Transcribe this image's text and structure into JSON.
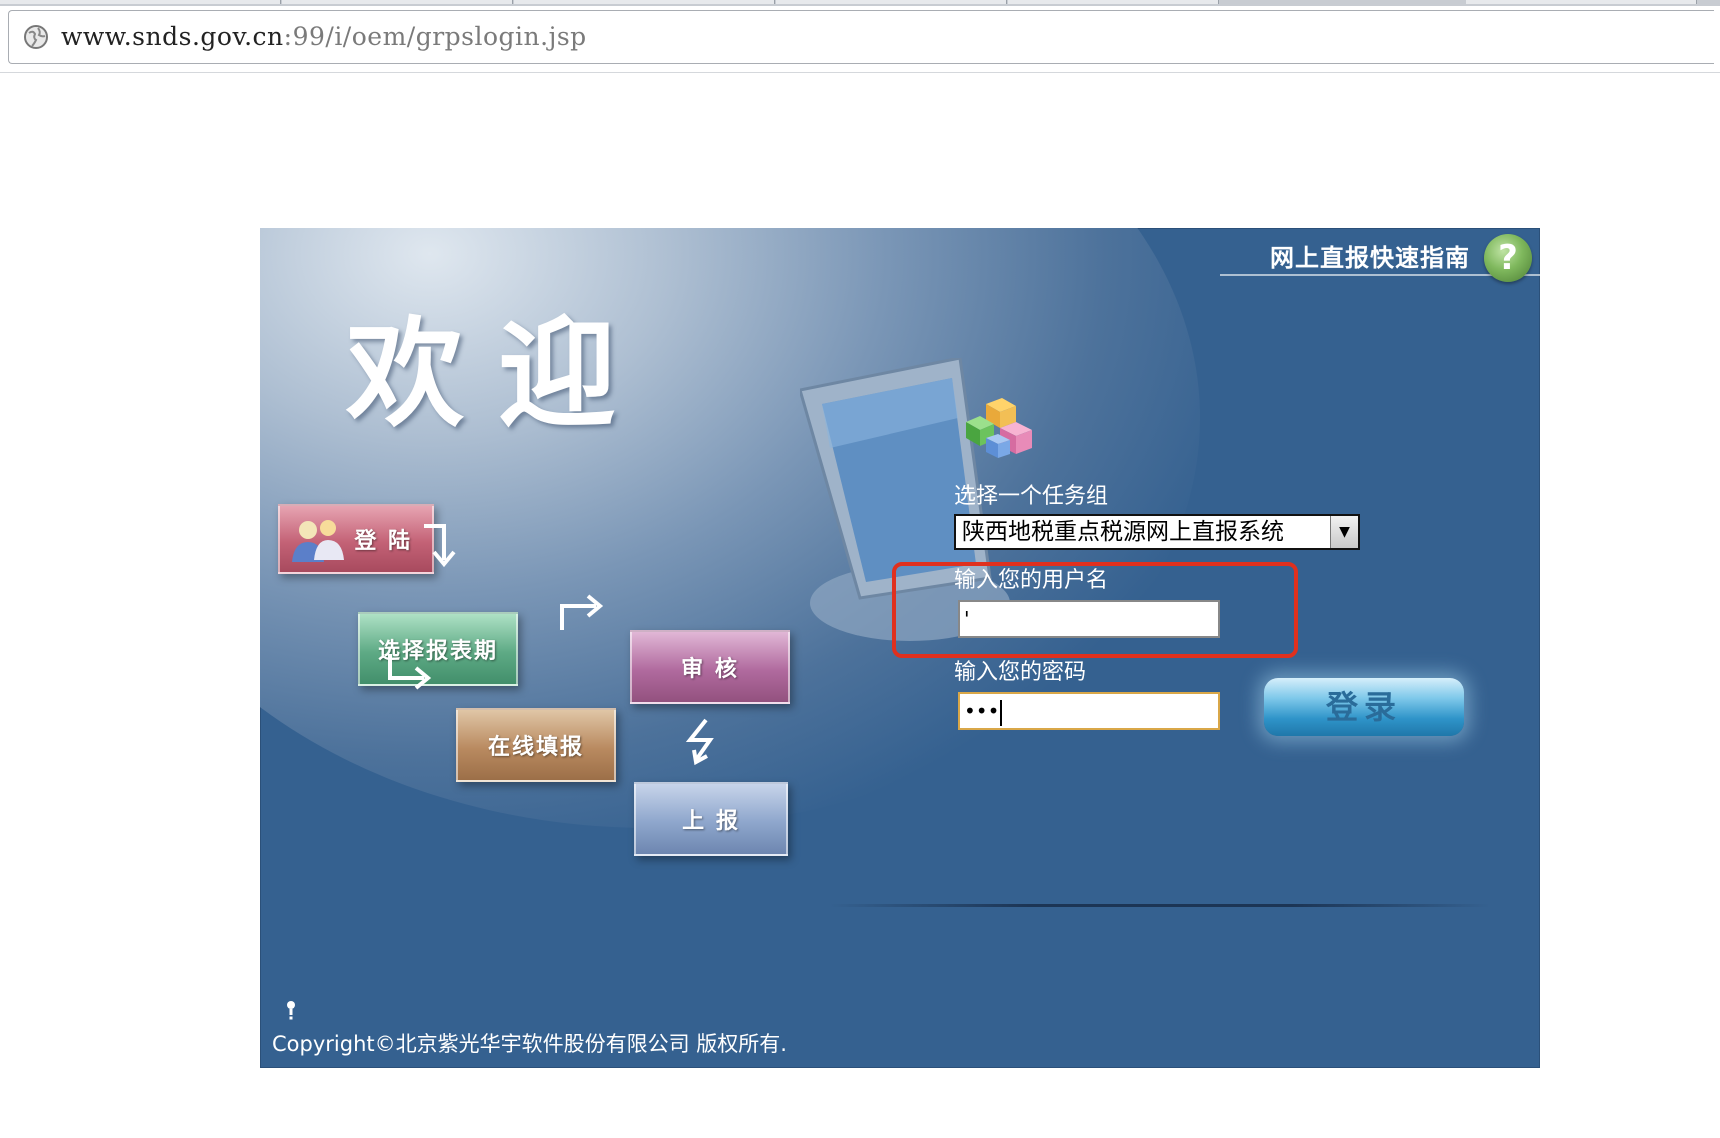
{
  "browser": {
    "url_host": "www.snds.gov.cn",
    "url_rest": ":99/i/oem/grpslogin.jsp"
  },
  "header": {
    "guide_link": "网上直报快速指南",
    "help_icon": "question-circle-icon",
    "help_glyph": "?"
  },
  "welcome": "欢迎",
  "flow": {
    "login": "登 陆",
    "select_period": "选择报表期",
    "fill_online": "在线填报",
    "audit": "审 核",
    "submit": "上 报"
  },
  "form": {
    "task_group_label": "选择一个任务组",
    "task_group_value": "陕西地税重点税源网上直报系统",
    "username_label": "输入您的用户名",
    "username_value": "'",
    "password_label": "输入您的密码",
    "password_value": "•••",
    "login_button": "登录"
  },
  "footer": {
    "copyright": "Copyright©北京紫光华宇软件股份有限公司 版权所有."
  },
  "colors": {
    "panel_bg": "#356190",
    "annotation": "#e0301e"
  }
}
